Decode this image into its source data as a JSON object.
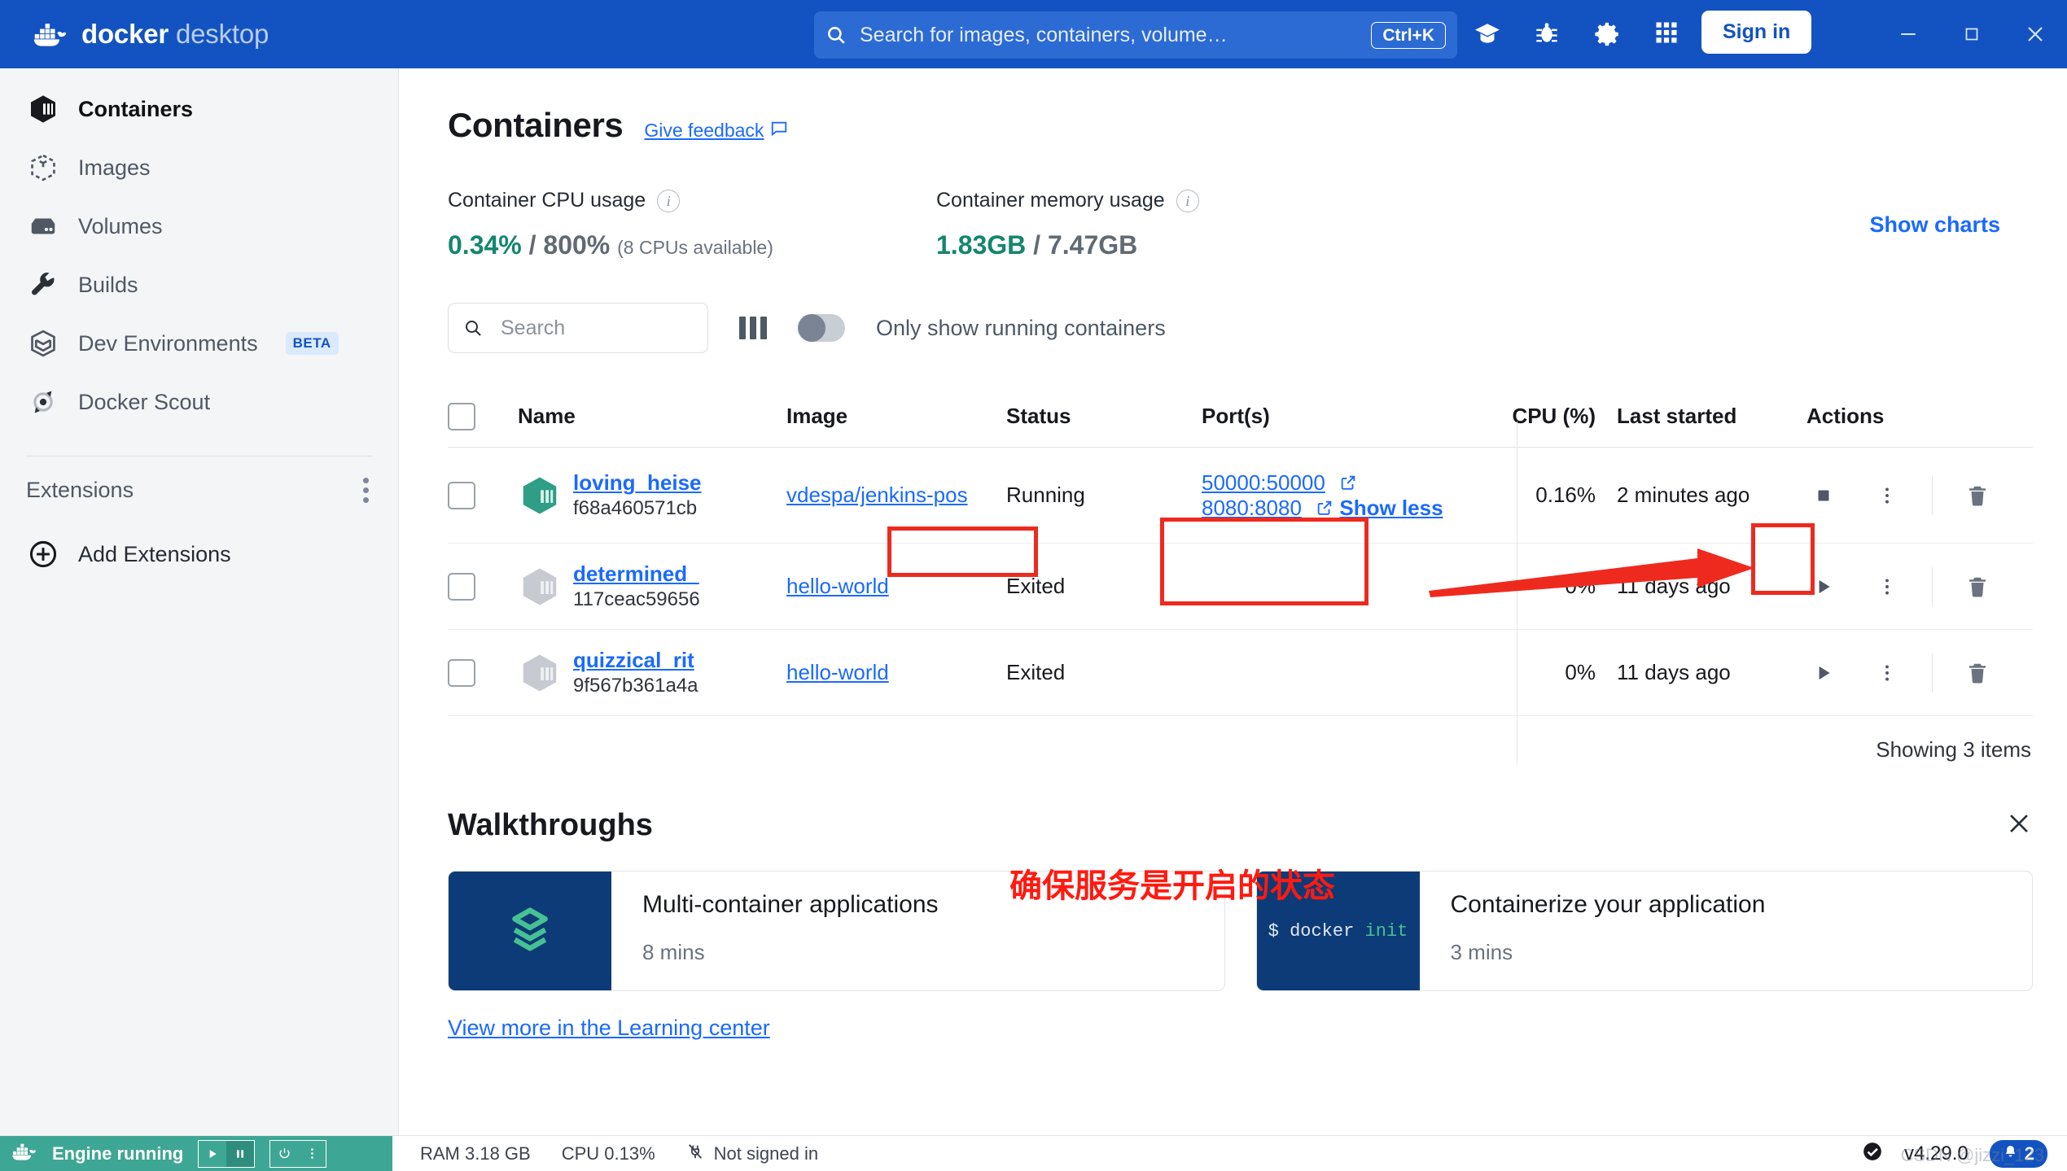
{
  "titlebar": {
    "brand_primary": "docker",
    "brand_secondary": "desktop",
    "search_placeholder": "Search for images, containers, volume…",
    "search_shortcut": "Ctrl+K",
    "signin_label": "Sign in",
    "icons": [
      "learning-center-icon",
      "bug-icon",
      "gear-icon",
      "grid-apps-icon"
    ],
    "window_controls": [
      "minimize",
      "maximize",
      "close"
    ],
    "bg_color": "#1353c1"
  },
  "sidebar": {
    "items": [
      {
        "label": "Containers",
        "icon": "container-icon",
        "active": true,
        "badge": ""
      },
      {
        "label": "Images",
        "icon": "images-icon",
        "active": false,
        "badge": ""
      },
      {
        "label": "Volumes",
        "icon": "volumes-icon",
        "active": false,
        "badge": ""
      },
      {
        "label": "Builds",
        "icon": "wrench-icon",
        "active": false,
        "badge": ""
      },
      {
        "label": "Dev Environments",
        "icon": "dev-env-icon",
        "active": false,
        "badge": "BETA"
      },
      {
        "label": "Docker Scout",
        "icon": "docker-scout-icon",
        "active": false,
        "badge": ""
      }
    ],
    "extensions_label": "Extensions",
    "add_extensions_label": "Add Extensions"
  },
  "main": {
    "page_title": "Containers",
    "feedback_label": "Give feedback",
    "stats": {
      "cpu_label": "Container CPU usage",
      "cpu_used": "0.34%",
      "cpu_sep": " / ",
      "cpu_total": "800%",
      "cpu_note": "(8 CPUs available)",
      "mem_label": "Container memory usage",
      "mem_used": "1.83GB",
      "mem_sep": " / ",
      "mem_total": "7.47GB",
      "show_charts_label": "Show charts"
    },
    "filters": {
      "search_placeholder": "Search",
      "toggle_label": "Only show running containers",
      "toggle_on": false
    },
    "table": {
      "headers": [
        "Name",
        "Image",
        "Status",
        "Port(s)",
        "CPU (%)",
        "Last started",
        "Actions"
      ],
      "rows": [
        {
          "name": "loving_heise",
          "id": "f68a460571cb",
          "image": "vdespa/jenkins-pos",
          "status": "Running",
          "ports": [
            "50000:50000",
            "8080:8080"
          ],
          "ports_toggle": "Show less",
          "cpu": "0.16%",
          "last_started": "2 minutes ago",
          "action_icon": "stop-icon",
          "running": true
        },
        {
          "name": "determined_",
          "id": "117ceac59656",
          "image": "hello-world",
          "status": "Exited",
          "ports": [],
          "ports_toggle": "",
          "cpu": "0%",
          "last_started": "11 days ago",
          "action_icon": "play-icon",
          "running": false
        },
        {
          "name": "quizzical_rit",
          "id": "9f567b361a4a",
          "image": "hello-world",
          "status": "Exited",
          "ports": [],
          "ports_toggle": "",
          "cpu": "0%",
          "last_started": "11 days ago",
          "action_icon": "play-icon",
          "running": false
        }
      ],
      "showing_label": "Showing 3 items"
    },
    "walkthroughs": {
      "title": "Walkthroughs",
      "cards": [
        {
          "title": "Multi-container applications",
          "time": "8 mins",
          "art": "layers-icon"
        },
        {
          "title": "Containerize your application",
          "time": "3 mins",
          "art": "docker init"
        }
      ],
      "view_more_label": "View more in the Learning center"
    }
  },
  "statusbar": {
    "engine_label": "Engine running",
    "ram_label": "RAM 3.18 GB",
    "cpu_label": "CPU 0.13%",
    "signed_in_label": "Not signed in",
    "version": "v4.29.0",
    "notification_count": "2"
  },
  "annotations": {
    "chinese_note": "确保服务是开启的状态",
    "highlight_color": "#ee2a1e",
    "watermark": "CSDN @jizzi_123"
  }
}
